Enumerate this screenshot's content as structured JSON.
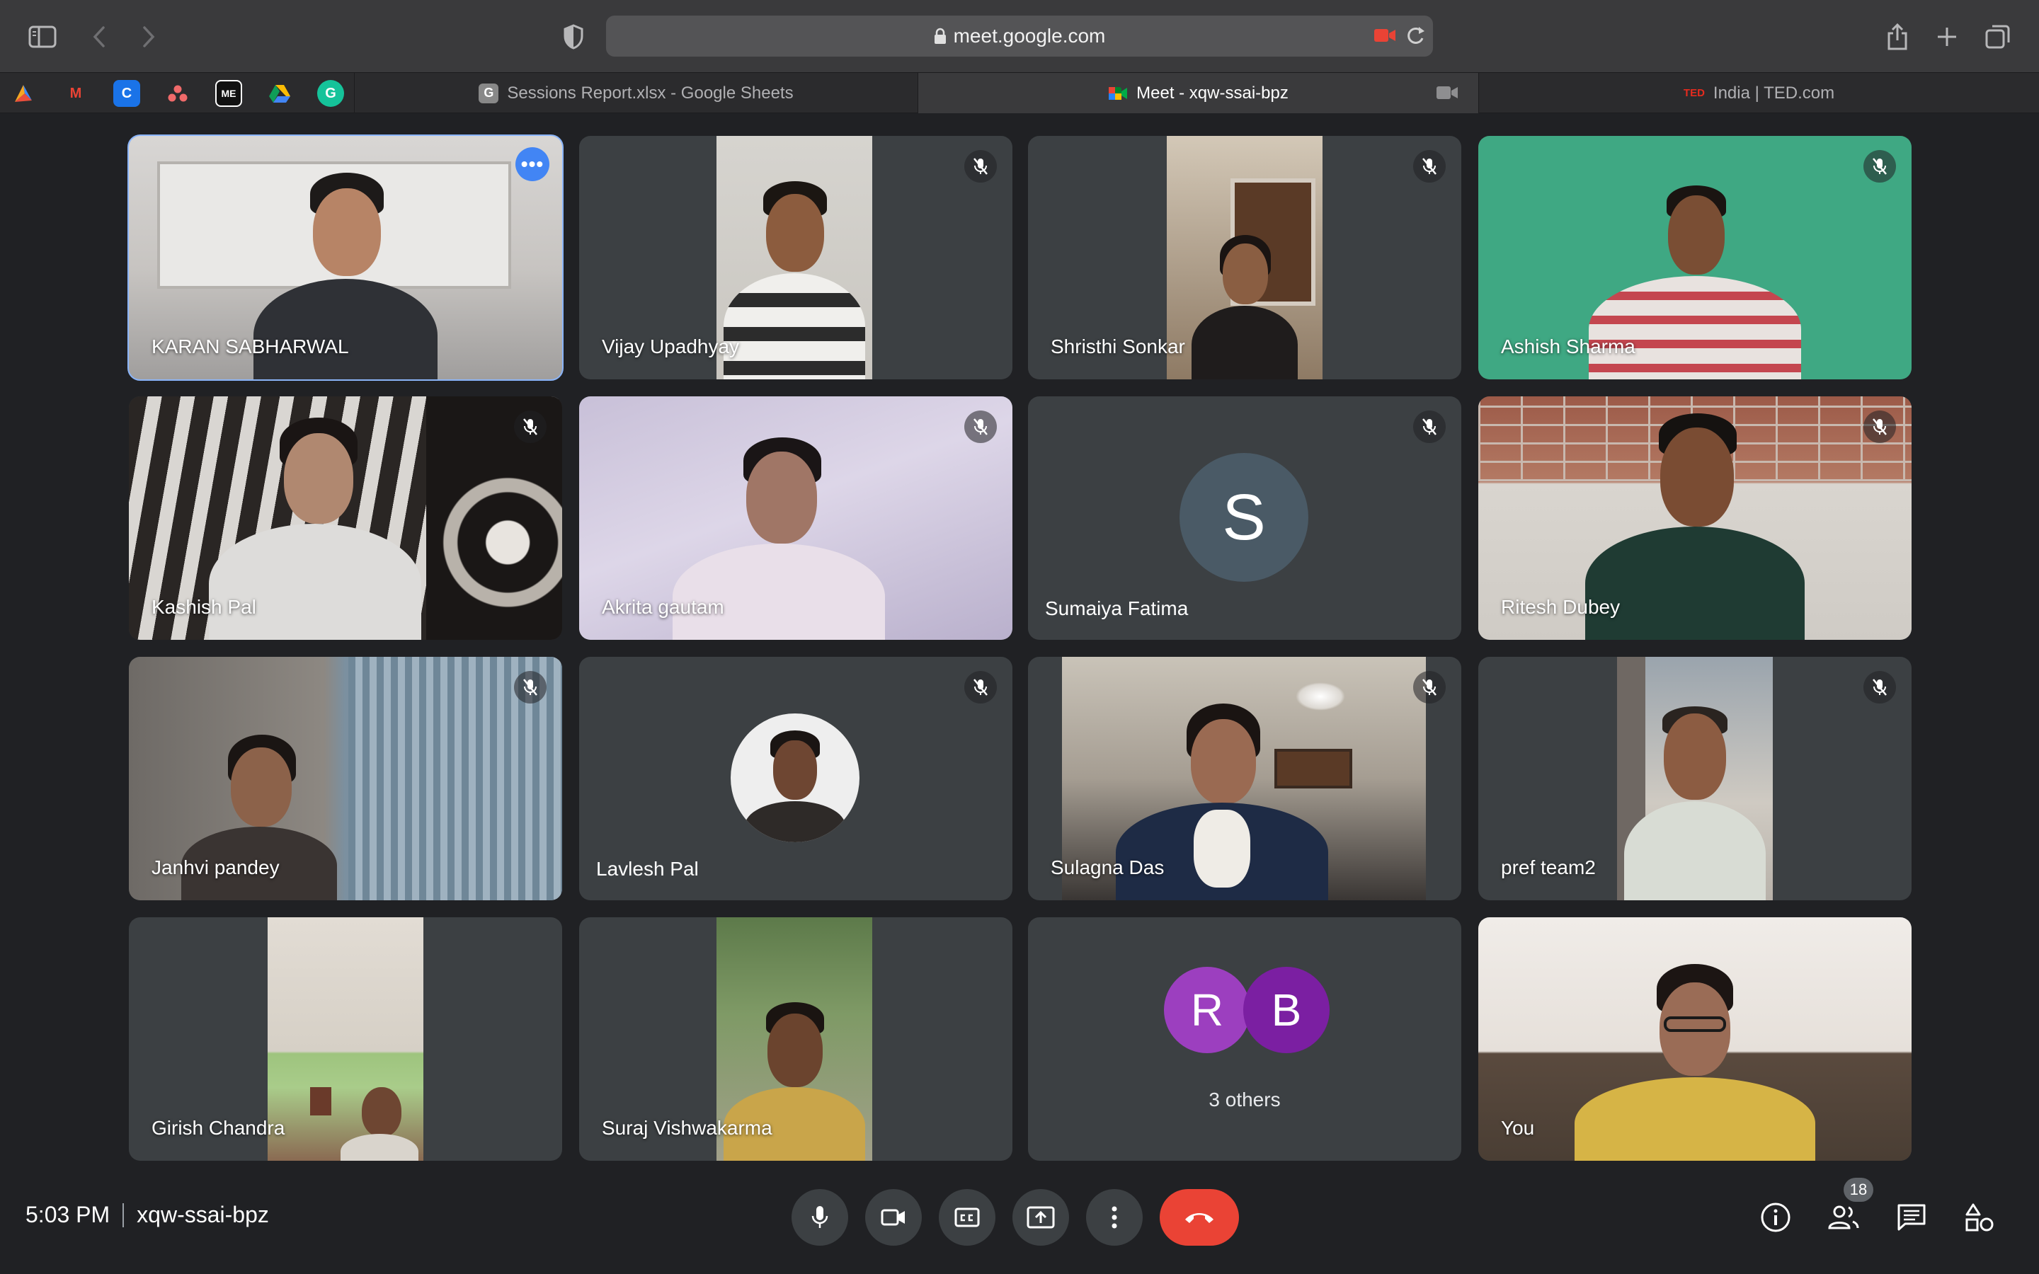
{
  "browser": {
    "url": "meet.google.com",
    "tabs": [
      {
        "label": "Sessions Report.xlsx - Google Sheets",
        "icon": "google-sheets-icon"
      },
      {
        "label": "Meet - xqw-ssai-bpz",
        "icon": "google-meet-icon",
        "active": true
      },
      {
        "label": "India | TED.com",
        "icon": "ted-icon",
        "badge": "TED"
      }
    ],
    "bookmarks": [
      "bookmark-app-icon",
      "gmail-icon",
      "c-app-icon",
      "asana-icon",
      "me-app-icon",
      "google-drive-icon",
      "grammarly-icon"
    ],
    "bookmark_texts": {
      "gmail": "M",
      "c": "C",
      "me": "ME",
      "g": "G",
      "sheets": "G"
    }
  },
  "meeting": {
    "time": "5:03 PM",
    "code": "xqw-ssai-bpz",
    "participant_count": "18",
    "tiles": [
      {
        "name": "KARAN SABHARWAL"
      },
      {
        "name": "Vijay Upadhyay"
      },
      {
        "name": "Shristhi Sonkar"
      },
      {
        "name": "Ashish Sharma"
      },
      {
        "name": "Kashish Pal"
      },
      {
        "name": "Akrita gautam"
      },
      {
        "name": "Sumaiya Fatima",
        "avatar_letter": "S"
      },
      {
        "name": "Ritesh Dubey"
      },
      {
        "name": "Janhvi pandey"
      },
      {
        "name": "Lavlesh Pal"
      },
      {
        "name": "Sulagna Das"
      },
      {
        "name": "pref team2"
      },
      {
        "name": "Girish Chandra"
      },
      {
        "name": "Suraj Vishwakarma"
      },
      {
        "name": "3 others",
        "avatars": [
          "R",
          "B"
        ]
      },
      {
        "name": "You"
      }
    ]
  },
  "colors": {
    "background": "#202124",
    "tile": "#3c4043",
    "active_outline": "#8ab4f8",
    "hangup": "#ea4335",
    "avatar_s": "#4a5a66",
    "avatar_r": "#9c3fbf",
    "avatar_b": "#7b1fa2"
  }
}
